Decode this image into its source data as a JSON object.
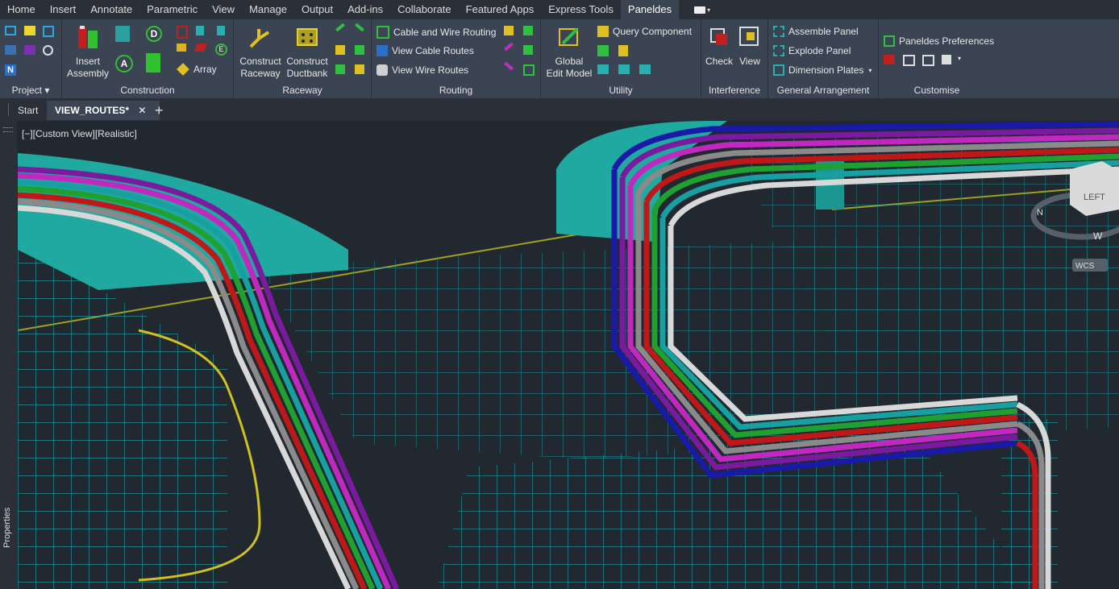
{
  "menu": {
    "tabs": [
      "Home",
      "Insert",
      "Annotate",
      "Parametric",
      "View",
      "Manage",
      "Output",
      "Add-ins",
      "Collaborate",
      "Featured Apps",
      "Express Tools",
      "Paneldes"
    ],
    "active_index": 11
  },
  "ribbon": {
    "project": {
      "title": "Project"
    },
    "construction": {
      "title": "Construction",
      "insert_assembly": "Insert\nAssembly",
      "array": "Array"
    },
    "raceway": {
      "title": "Raceway",
      "construct_raceway": "Construct\nRaceway",
      "construct_ductbank": "Construct\nDuctbank"
    },
    "routing": {
      "title": "Routing",
      "cable_wire_routing": "Cable and Wire Routing",
      "view_cable_routes": "View Cable Routes",
      "view_wire_routes": "View Wire Routes"
    },
    "utility": {
      "title": "Utility",
      "global_edit_model": "Global\nEdit Model",
      "query_component": "Query Component"
    },
    "interference": {
      "title": "Interference",
      "check": "Check",
      "view": "View"
    },
    "general_arrangement": {
      "title": "General Arrangement",
      "assemble_panel": "Assemble Panel",
      "explode_panel": "Explode Panel",
      "dimension_plates": "Dimension Plates"
    },
    "customise": {
      "title": "Customise",
      "preferences": "Paneldes Preferences"
    }
  },
  "doc_tabs": {
    "start": "Start",
    "active": "VIEW_ROUTES*",
    "close": "✕",
    "new": "+"
  },
  "viewport": {
    "label": "[−][Custom View][Realistic]",
    "viewcube_face": "LEFT",
    "compass_w": "W",
    "compass_n": "N",
    "wcs": "WCS"
  },
  "sidebar": {
    "properties": "Properties"
  },
  "colors": {
    "cables": [
      "#1a1aa8",
      "#7a1a9e",
      "#c028c0",
      "#8a8a8a",
      "#c01818",
      "#20a030",
      "#18a0a0",
      "#d8d8d8",
      "#e0c000",
      "#707070"
    ],
    "tray": "#1f8f96",
    "duct": "#1fa9a0"
  }
}
